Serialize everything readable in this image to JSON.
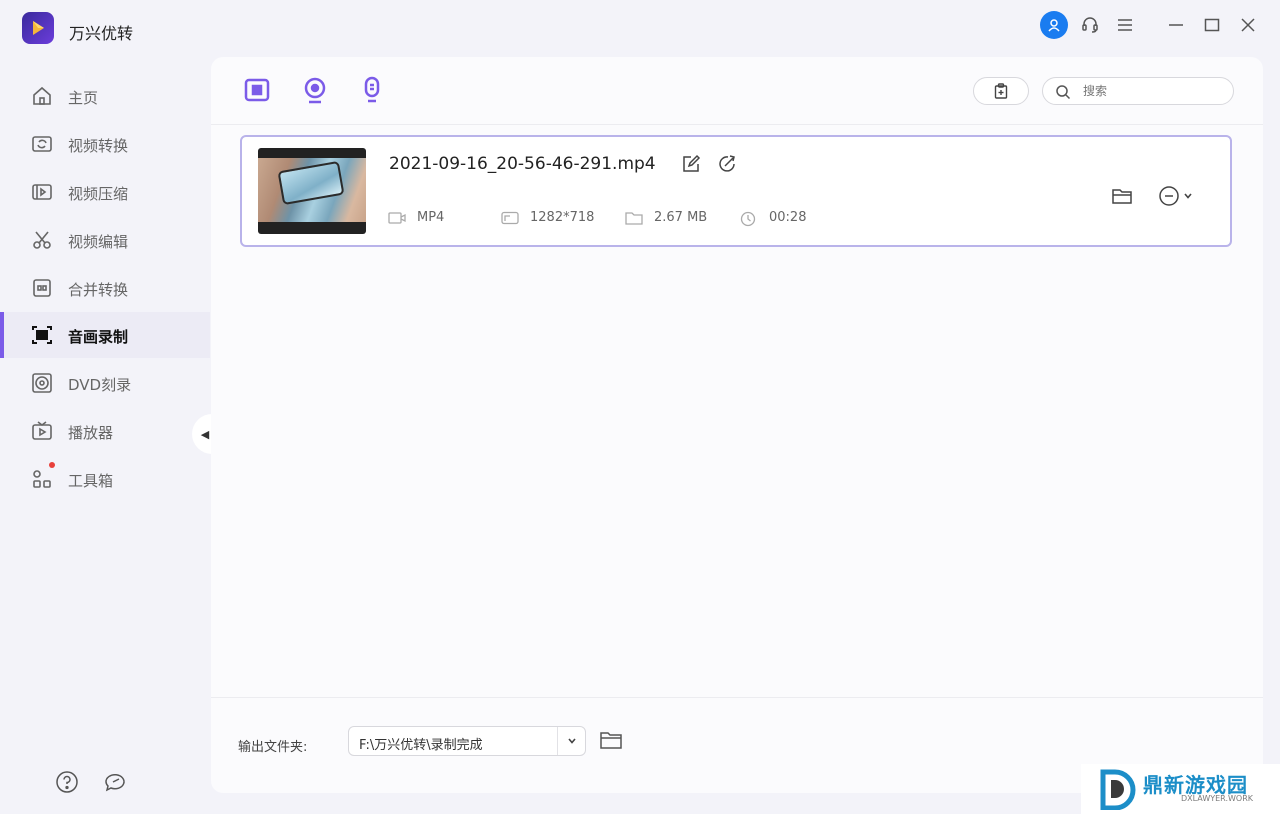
{
  "app": {
    "title": "万兴优转"
  },
  "sidebar": {
    "items": [
      {
        "label": "主页",
        "icon": "home-icon"
      },
      {
        "label": "视频转换",
        "icon": "video-convert-icon"
      },
      {
        "label": "视频压缩",
        "icon": "video-compress-icon"
      },
      {
        "label": "视频编辑",
        "icon": "scissors-icon"
      },
      {
        "label": "合并转换",
        "icon": "merge-icon"
      },
      {
        "label": "音画录制",
        "icon": "screen-record-icon",
        "active": true
      },
      {
        "label": "DVD刻录",
        "icon": "dvd-icon"
      },
      {
        "label": "播放器",
        "icon": "player-icon"
      },
      {
        "label": "工具箱",
        "icon": "toolbox-icon"
      }
    ]
  },
  "toolbar": {
    "search_placeholder": "搜索"
  },
  "file": {
    "name": "2021-09-16_20-56-46-291.mp4",
    "format": "MP4",
    "resolution": "1282*718",
    "size": "2.67 MB",
    "duration": "00:28"
  },
  "footer": {
    "output_label": "输出文件夹:",
    "output_path": "F:\\万兴优转\\录制完成"
  },
  "watermark": {
    "title": "鼎新游戏园",
    "subtitle": "DXLAWYER.WORK"
  },
  "colors": {
    "accent": "#7b5be8",
    "card_border": "#b9b3ea",
    "avatar": "#1a7cf0"
  }
}
